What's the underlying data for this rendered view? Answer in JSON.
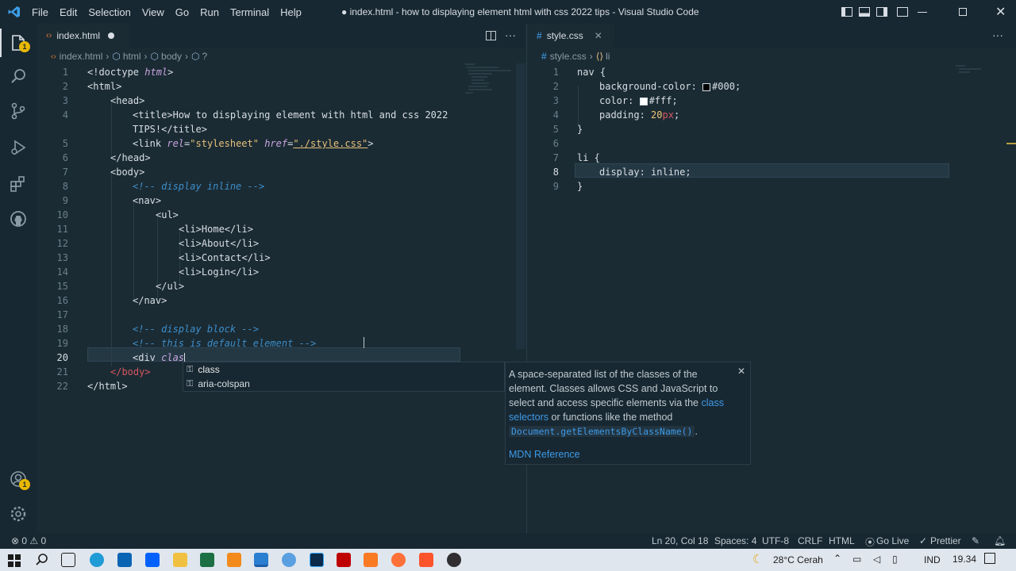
{
  "window": {
    "title": "● index.html - how to displaying element html with css 2022 tips - Visual Studio Code",
    "menu": [
      "File",
      "Edit",
      "Selection",
      "View",
      "Go",
      "Run",
      "Terminal",
      "Help"
    ]
  },
  "activity": {
    "explorer_badge": "1",
    "accounts_badge": "1"
  },
  "left_editor": {
    "tab_label": "index.html",
    "breadcrumbs": [
      "index.html",
      "html",
      "body",
      "?"
    ],
    "lines": [
      {
        "n": "1"
      },
      {
        "n": "2"
      },
      {
        "n": "3"
      },
      {
        "n": "4"
      },
      {
        "n": ""
      },
      {
        "n": "5"
      },
      {
        "n": "6"
      },
      {
        "n": "7"
      },
      {
        "n": "8"
      },
      {
        "n": "9"
      },
      {
        "n": "10"
      },
      {
        "n": "11"
      },
      {
        "n": "12"
      },
      {
        "n": "13"
      },
      {
        "n": "14"
      },
      {
        "n": "15"
      },
      {
        "n": "16"
      },
      {
        "n": "17"
      },
      {
        "n": "18"
      },
      {
        "n": "19"
      },
      {
        "n": "20"
      },
      {
        "n": "21"
      },
      {
        "n": "22"
      }
    ],
    "text": {
      "l1": "<!doctype html>",
      "l2": "<html>",
      "l3": "<head>",
      "l4a": "<title>How to displaying element with html and css 2022",
      "l4b": "TIPS!</title>",
      "l5_tag": "<link ",
      "l5_rel": "rel",
      "l5_eq1": "=",
      "l5_relv": "\"stylesheet\"",
      "l5_href": " href",
      "l5_eq2": "=",
      "l5_hrefv": "\"./style.css\"",
      "l5_end": ">",
      "l6": "</head>",
      "l7": "<body>",
      "l8": "<!-- display inline -->",
      "l9": "<nav>",
      "l10": "<ul>",
      "l11": "<li>Home</li>",
      "l12": "<li>About</li>",
      "l13": "<li>Contact</li>",
      "l14": "<li>Login</li>",
      "l15": "</ul>",
      "l16": "</nav>",
      "l18": "<!-- display block -->",
      "l19": "<!-- this is default element -->",
      "l20a": "<div ",
      "l20b": "clas",
      "l21": "</body>",
      "l22": "</html>"
    }
  },
  "right_editor": {
    "tab_label": "style.css",
    "breadcrumbs": [
      "style.css",
      "li"
    ],
    "line_numbers": [
      "1",
      "2",
      "3",
      "4",
      "5",
      "6",
      "7",
      "8",
      "9"
    ],
    "text": {
      "l1": "nav {",
      "l2p": "background-color: ",
      "l2v": "#000",
      "l2e": ";",
      "l3p": "color: ",
      "l3v": "#fff",
      "l3e": ";",
      "l4p": "padding: ",
      "l4v": "20",
      "l4u": "px",
      "l4e": ";",
      "l5": "}",
      "l7": "li {",
      "l8": "display: inline;",
      "l9": "}"
    },
    "colors": {
      "black": "#000000",
      "white": "#ffffff"
    }
  },
  "suggest": {
    "items": [
      "class",
      "aria-colspan"
    ]
  },
  "doc": {
    "text1": "A space-separated list of the classes of the element. Classes allows CSS and JavaScript to select and access specific elements via the ",
    "link1": "class selectors",
    "text2": " or functions like the method ",
    "code": "Document.getElementsByClassName()",
    "text3": ".",
    "reference": "MDN Reference"
  },
  "status": {
    "problems": "⊗ 0 ⚠ 0",
    "position": "Ln 20, Col 18",
    "spaces": "Spaces: 4",
    "encoding": "UTF-8",
    "eol": "CRLF",
    "language": "HTML",
    "golive": "Go Live",
    "prettier": "Prettier"
  },
  "taskbar": {
    "weather": "28°C  Cerah",
    "lang": "IND",
    "time": "19.34"
  }
}
